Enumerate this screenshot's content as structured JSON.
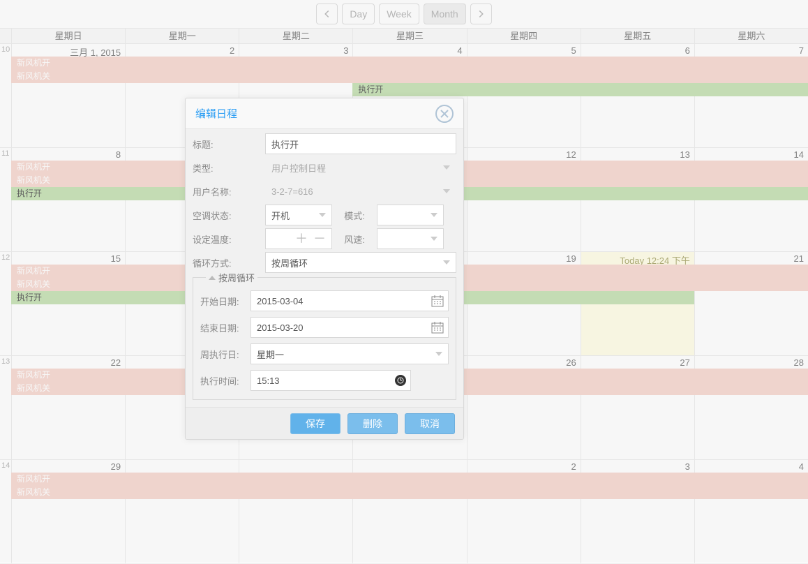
{
  "nav": {
    "day": "Day",
    "week": "Week",
    "month": "Month"
  },
  "day_headers": [
    "星期日",
    "星期一",
    "星期二",
    "星期三",
    "星期四",
    "星期五",
    "星期六"
  ],
  "weeks": [
    {
      "num": "10",
      "cells": [
        "三月 1, 2015",
        "2",
        "3",
        "4",
        "5",
        "6",
        "7"
      ],
      "events": [
        {
          "color": "pink",
          "from": 0,
          "to": 7,
          "text": "新风机开",
          "row": 0
        },
        {
          "color": "pink",
          "from": 0,
          "to": 7,
          "text": "新风机关",
          "row": 1
        },
        {
          "color": "green",
          "from": 3,
          "to": 7,
          "text": "执行开",
          "row": 2
        }
      ]
    },
    {
      "num": "11",
      "cells": [
        "8",
        "",
        "",
        "",
        "12",
        "13",
        "14"
      ],
      "events": [
        {
          "color": "pink",
          "from": 0,
          "to": 7,
          "text": "新风机开",
          "row": 0
        },
        {
          "color": "pink",
          "from": 0,
          "to": 7,
          "text": "新风机关",
          "row": 1
        },
        {
          "color": "green",
          "from": 0,
          "to": 7,
          "text": "执行开",
          "row": 2
        }
      ]
    },
    {
      "num": "12",
      "cells": [
        "15",
        "",
        "",
        "",
        "19",
        "Today 12:24 下午",
        "21"
      ],
      "todayIndex": 5,
      "events": [
        {
          "color": "pink",
          "from": 0,
          "to": 7,
          "text": "新风机开",
          "row": 0
        },
        {
          "color": "pink",
          "from": 0,
          "to": 7,
          "text": "新风机关",
          "row": 1
        },
        {
          "color": "green",
          "from": 0,
          "to": 6,
          "text": "执行开",
          "row": 2
        }
      ]
    },
    {
      "num": "13",
      "cells": [
        "22",
        "",
        "",
        "",
        "26",
        "27",
        "28"
      ],
      "events": [
        {
          "color": "pink",
          "from": 0,
          "to": 7,
          "text": "新风机开",
          "row": 0
        },
        {
          "color": "pink",
          "from": 0,
          "to": 7,
          "text": "新风机关",
          "row": 1
        }
      ]
    },
    {
      "num": "14",
      "cells": [
        "29",
        "",
        "",
        "",
        "2",
        "3",
        "4"
      ],
      "events": [
        {
          "color": "pink",
          "from": 0,
          "to": 7,
          "text": "新风机开",
          "row": 0
        },
        {
          "color": "pink",
          "from": 0,
          "to": 7,
          "text": "新风机关",
          "row": 1
        }
      ]
    }
  ],
  "modal": {
    "title": "编辑日程",
    "labels": {
      "title": "标题:",
      "type": "类型:",
      "user": "用户名称:",
      "ac_state": "空调状态:",
      "mode": "模式:",
      "set_temp": "设定温度:",
      "fan": "风速:",
      "cycle": "循环方式:",
      "groupTitle": "按周循环",
      "start_date": "开始日期:",
      "end_date": "结束日期:",
      "weekday": "周执行日:",
      "exec_time": "执行时间:"
    },
    "values": {
      "title": "执行开",
      "type": "用户控制日程",
      "user": "3-2-7=616",
      "ac_state": "开机",
      "mode": "",
      "set_temp": "",
      "fan": "",
      "cycle": "按周循环",
      "start_date": "2015-03-04",
      "end_date": "2015-03-20",
      "weekday": "星期一",
      "exec_time": "15:13"
    },
    "buttons": {
      "save": "保存",
      "delete": "删除",
      "cancel": "取消"
    }
  }
}
